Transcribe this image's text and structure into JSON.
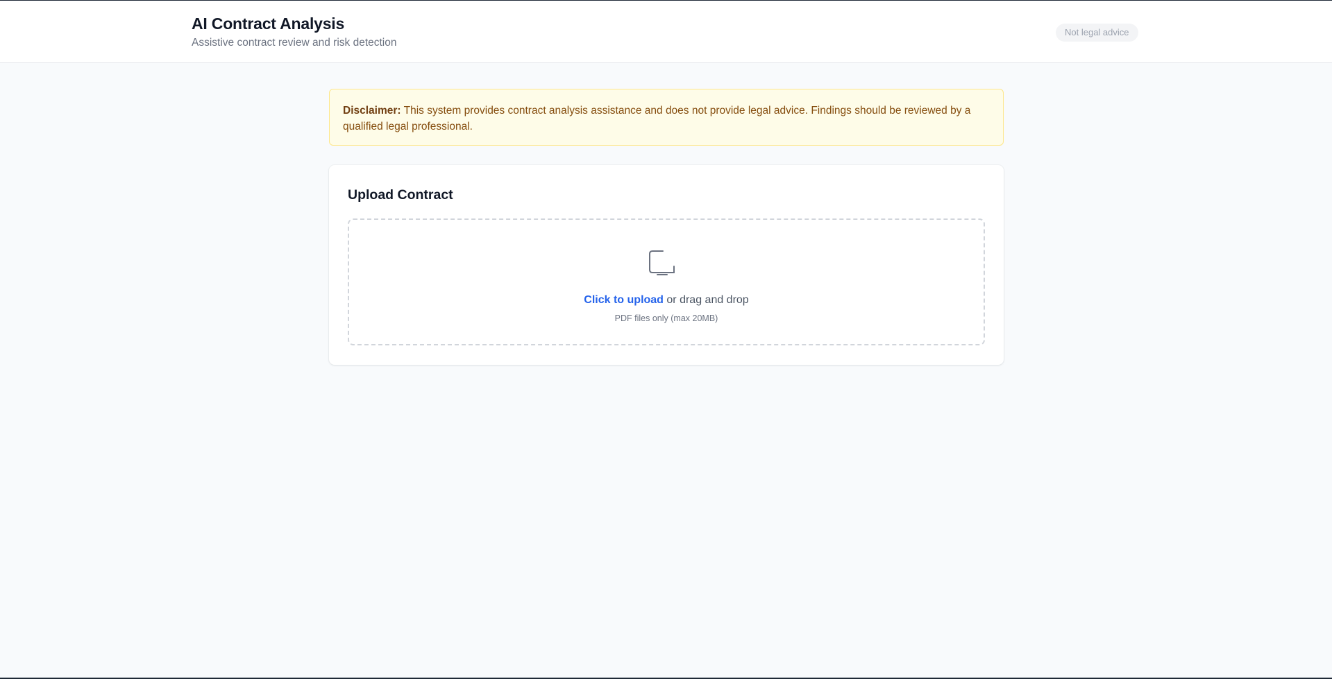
{
  "header": {
    "title": "AI Contract Analysis",
    "subtitle": "Assistive contract review and risk detection",
    "badge": "Not legal advice"
  },
  "disclaimer": {
    "label": "Disclaimer:",
    "text": "This system provides contract analysis assistance and does not provide legal advice. Findings should be reviewed by a qualified legal professional."
  },
  "upload": {
    "title": "Upload Contract",
    "icon": "upload-file-icon",
    "link_text": "Click to upload",
    "rest_text": " or drag and drop",
    "hint": "PDF files only (max 20MB)"
  },
  "colors": {
    "accent": "#2563eb",
    "background": "#f8fafc",
    "disclaimer_bg": "#fefce8",
    "disclaimer_border": "#fde68a",
    "disclaimer_text": "#854d0e"
  }
}
